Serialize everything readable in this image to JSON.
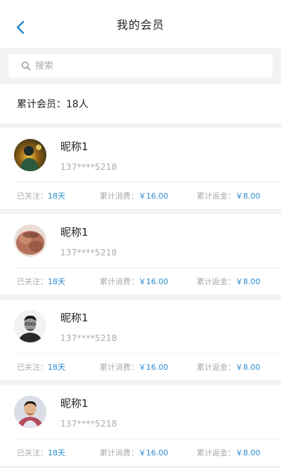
{
  "header": {
    "title": "我的会员",
    "back_icon": "chevron-left-icon"
  },
  "search": {
    "placeholder": "搜索",
    "icon": "search-icon"
  },
  "summary": {
    "text": "累计会员：18人"
  },
  "colors": {
    "accent": "#2b8bd1",
    "label": "#aaaaaa",
    "background": "#f2f2f2"
  },
  "members": [
    {
      "nickname": "昵称1",
      "phone": "137****5218",
      "follow_label": "已关注：",
      "follow_value": "18天",
      "spend_label": "累计消费：",
      "spend_value": "￥16.00",
      "rebate_label": "累计返金：",
      "rebate_value": "￥8.00"
    },
    {
      "nickname": "昵称1",
      "phone": "137****5218",
      "follow_label": "已关注：",
      "follow_value": "18天",
      "spend_label": "累计消费：",
      "spend_value": "￥16.00",
      "rebate_label": "累计返金：",
      "rebate_value": "￥8.00"
    },
    {
      "nickname": "昵称1",
      "phone": "137****5218",
      "follow_label": "已关注：",
      "follow_value": "18天",
      "spend_label": "累计消费：",
      "spend_value": "￥16.00",
      "rebate_label": "累计返金：",
      "rebate_value": "￥8.00"
    },
    {
      "nickname": "昵称1",
      "phone": "137****5218",
      "follow_label": "已关注：",
      "follow_value": "18天",
      "spend_label": "累计消费：",
      "spend_value": "￥16.00",
      "rebate_label": "累计返金：",
      "rebate_value": "￥8.00"
    }
  ]
}
